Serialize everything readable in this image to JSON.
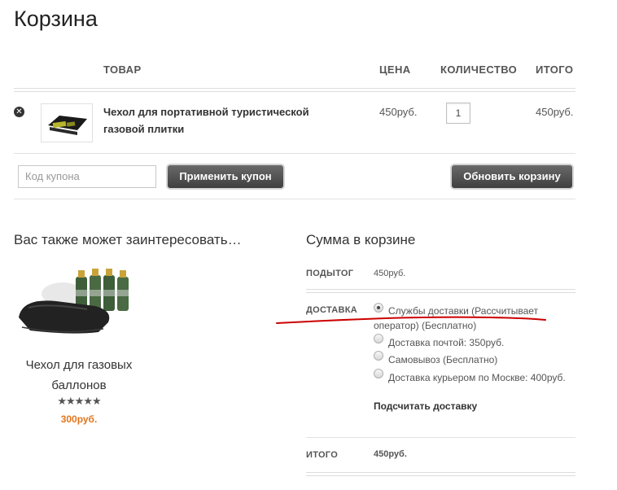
{
  "page": {
    "title": "Корзина"
  },
  "cart": {
    "columns": {
      "product": "ТОВАР",
      "price": "ЦЕНА",
      "quantity": "КОЛИЧЕСТВО",
      "total": "ИТОГО"
    },
    "items": [
      {
        "name": "Чехол для портативной туристической газовой плитки",
        "price": "450руб.",
        "quantity": "1",
        "subtotal": "450руб."
      }
    ],
    "coupon_placeholder": "Код купона",
    "apply_coupon_label": "Применить купон",
    "update_cart_label": "Обновить корзину"
  },
  "related": {
    "title": "Вас также может заинтересовать…",
    "products": [
      {
        "name": "Чехол для газовых баллонов",
        "rating_stars": "★★★★★",
        "rating": 5,
        "price": "300руб."
      }
    ]
  },
  "totals": {
    "title": "Сумма в корзине",
    "subtotal_label": "ПОДЫТОГ",
    "subtotal_value": "450руб.",
    "shipping_label": "ДОСТАВКА",
    "shipping_options": [
      {
        "label": "Службы доставки (Рассчитывает оператор) (Бесплатно)",
        "checked": true
      },
      {
        "label": "Доставка почтой: 350руб.",
        "checked": false
      },
      {
        "label": "Самовывоз (Бесплатно)",
        "checked": false
      },
      {
        "label": "Доставка курьером по Москве: 400руб.",
        "checked": false
      }
    ],
    "calc_shipping_label": "Подсчитать доставку",
    "total_label": "ИТОГО",
    "total_value": "450руб."
  },
  "colors": {
    "accent_price": "#e2741b",
    "annotation_line": "#cc0000",
    "button_dark": "#4a4a4a"
  }
}
